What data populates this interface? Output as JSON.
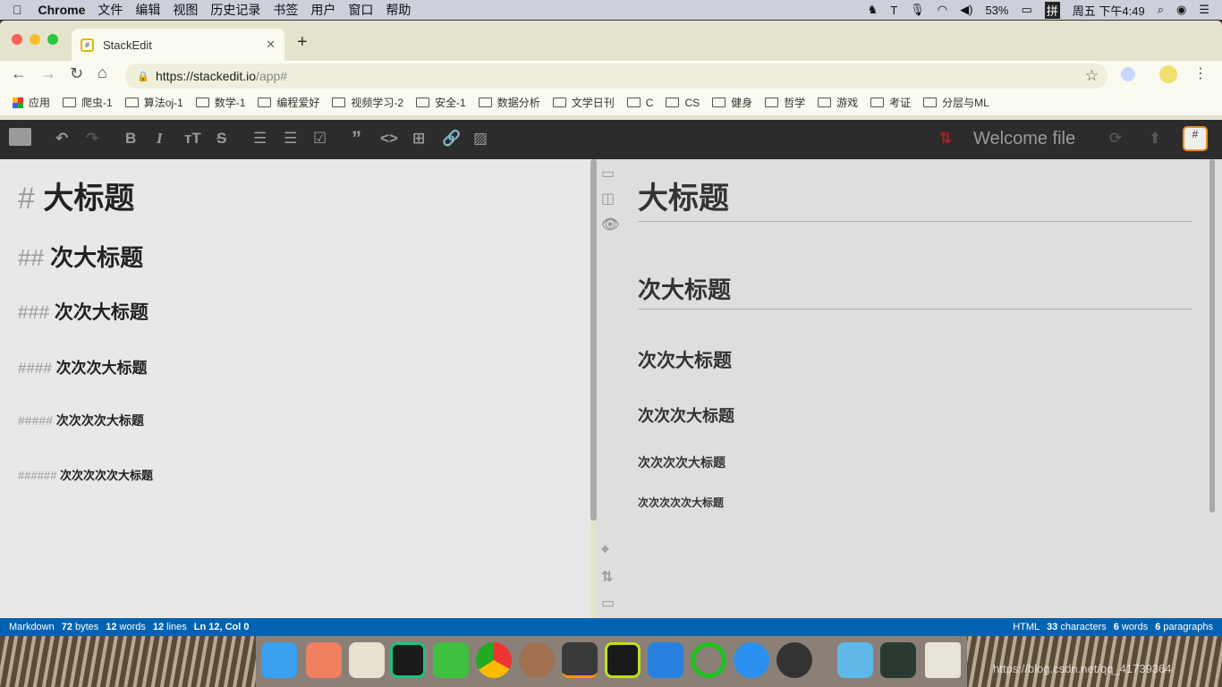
{
  "menubar": {
    "app": "Chrome",
    "items": [
      "文件",
      "编辑",
      "视图",
      "历史记录",
      "书签",
      "用户",
      "窗口",
      "帮助"
    ],
    "battery": "53%",
    "input": "拼",
    "clock": "周五 下午4:49"
  },
  "browser": {
    "tab_title": "StackEdit",
    "url_host": "https://stackedit.io",
    "url_path": "/app#",
    "bookmarks": [
      "应用",
      "爬虫-1",
      "算法oj-1",
      "数学-1",
      "编程爱好",
      "视频学习-2",
      "安全-1",
      "数据分析",
      "文学日刊",
      "C",
      "CS",
      "健身",
      "哲学",
      "游戏",
      "考证",
      "分层与ML"
    ]
  },
  "toolbar": {
    "file_title": "Welcome file"
  },
  "editor": {
    "lines": [
      {
        "mark": "#",
        "text": "大标题"
      },
      {
        "mark": "##",
        "text": "次大标题"
      },
      {
        "mark": "###",
        "text": "次次大标题"
      },
      {
        "mark": "####",
        "text": "次次次大标题"
      },
      {
        "mark": "#####",
        "text": "次次次次大标题"
      },
      {
        "mark": "######",
        "text": "次次次次次大标题"
      }
    ]
  },
  "preview": {
    "headings": [
      "大标题",
      "次大标题",
      "次次大标题",
      "次次次大标题",
      "次次次次大标题",
      "次次次次次大标题"
    ]
  },
  "status": {
    "left": {
      "mode": "Markdown",
      "bytes": "72",
      "bytes_l": "bytes",
      "words": "12",
      "words_l": "words",
      "lines": "12",
      "lines_l": "lines",
      "pos": "Ln 12, Col 0"
    },
    "right": {
      "mode": "HTML",
      "chars": "33",
      "chars_l": "characters",
      "words": "6",
      "words_l": "words",
      "paras": "6",
      "paras_l": "paragraphs"
    }
  },
  "watermark": "https://blog.csdn.net/qq_41739364",
  "colors": {
    "status_bar": "#0063b1",
    "toolbar": "#2c2c2c",
    "sync_off": "#b02020"
  }
}
